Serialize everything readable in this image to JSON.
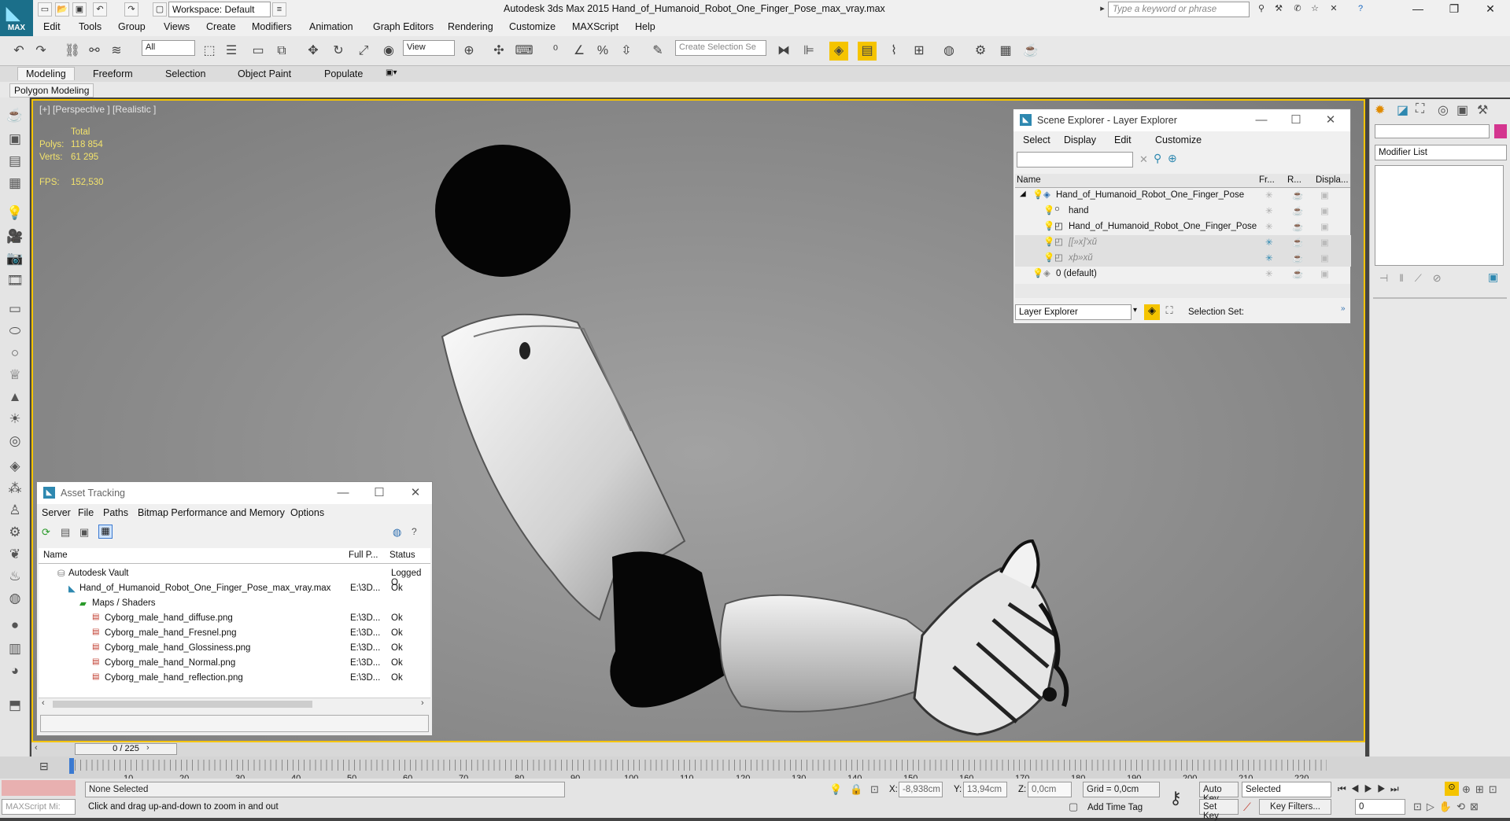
{
  "app": {
    "title": "Autodesk 3ds Max  2015    Hand_of_Humanoid_Robot_One_Finger_Pose_max_vray.max",
    "logo_label": "MAX"
  },
  "quickaccess": {
    "workspace": "Workspace: Default",
    "search_placeholder": "Type a keyword or phrase"
  },
  "menu": [
    "Edit",
    "Tools",
    "Group",
    "Views",
    "Create",
    "Modifiers",
    "Animation",
    "Graph Editors",
    "Rendering",
    "Customize",
    "MAXScript",
    "Help"
  ],
  "toolbar": {
    "filter": "All",
    "refcoord": "View",
    "selection_set_placeholder": "Create Selection Se"
  },
  "ribbon": {
    "tabs": [
      "Modeling",
      "Freeform",
      "Selection",
      "Object Paint",
      "Populate"
    ],
    "subtab": "Polygon Modeling"
  },
  "viewport": {
    "label": "[+] [Perspective ] [Realistic ]",
    "stats": {
      "total_label": "Total",
      "polys_label": "Polys:",
      "polys": "118 854",
      "verts_label": "Verts:",
      "verts": "61 295",
      "fps_label": "FPS:",
      "fps": "152,530"
    }
  },
  "scene_explorer": {
    "title": "Scene Explorer - Layer Explorer",
    "menu": [
      "Select",
      "Display",
      "Edit",
      "Customize"
    ],
    "columns": [
      "Name",
      "Fr...",
      "R...",
      "Displa..."
    ],
    "rows": [
      {
        "name": "Hand_of_Humanoid_Robot_One_Finger_Pose"
      },
      {
        "name": "hand"
      },
      {
        "name": "Hand_of_Humanoid_Robot_One_Finger_Pose"
      },
      {
        "name": "[[»x]'xŭ"
      },
      {
        "name": "xþ»xŭ"
      },
      {
        "name": "0 (default)"
      }
    ],
    "footer_dropdown": "Layer Explorer",
    "selection_set_label": "Selection Set:"
  },
  "modifier_panel": {
    "modifier_list": "Modifier List"
  },
  "asset_tracking": {
    "title": "Asset Tracking",
    "menu": [
      "Server",
      "File",
      "Paths",
      "Bitmap Performance and Memory",
      "Options"
    ],
    "columns": [
      "Name",
      "Full P...",
      "Status"
    ],
    "rows": [
      {
        "name": "Autodesk Vault",
        "path": "",
        "status": "Logged O"
      },
      {
        "name": "Hand_of_Humanoid_Robot_One_Finger_Pose_max_vray.max",
        "path": "E:\\3D...",
        "status": "Ok"
      },
      {
        "name": "Maps / Shaders",
        "path": "",
        "status": ""
      },
      {
        "name": "Cyborg_male_hand_diffuse.png",
        "path": "E:\\3D...",
        "status": "Ok"
      },
      {
        "name": "Cyborg_male_hand_Fresnel.png",
        "path": "E:\\3D...",
        "status": "Ok"
      },
      {
        "name": "Cyborg_male_hand_Glossiness.png",
        "path": "E:\\3D...",
        "status": "Ok"
      },
      {
        "name": "Cyborg_male_hand_Normal.png",
        "path": "E:\\3D...",
        "status": "Ok"
      },
      {
        "name": "Cyborg_male_hand_reflection.png",
        "path": "E:\\3D...",
        "status": "Ok"
      }
    ]
  },
  "timeline": {
    "frame": "0 / 225",
    "ticks": [
      "10",
      "20",
      "30",
      "40",
      "50",
      "60",
      "70",
      "80",
      "90",
      "100",
      "110",
      "120",
      "130",
      "140",
      "150",
      "160",
      "170",
      "180",
      "190",
      "200",
      "210",
      "220"
    ]
  },
  "status": {
    "selection": "None Selected",
    "prompt": "Click and drag up-and-down to zoom in and out",
    "maxscript": "MAXScript Mi:",
    "x_label": "X:",
    "x": "-8,938cm",
    "y_label": "Y:",
    "y": "13,94cm",
    "z_label": "Z:",
    "z": "0,0cm",
    "grid": "Grid = 0,0cm",
    "add_time_tag": "Add Time Tag",
    "auto_key": "Auto Key",
    "set_key": "Set Key",
    "key_mode": "Selected",
    "key_filters": "Key Filters...",
    "frame_field": "0"
  },
  "colors": {
    "viewport_border": "#f5c400",
    "stats_text": "#f3e36c",
    "logo_bg": "#1b6f8a"
  }
}
